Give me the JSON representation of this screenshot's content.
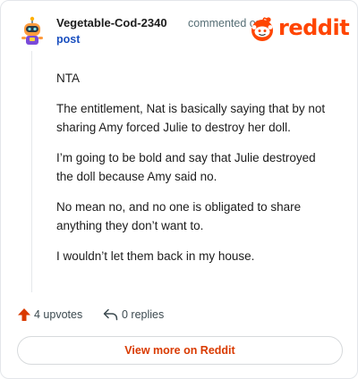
{
  "header": {
    "author": "Vegetable-Cod-2340",
    "action": "commented on",
    "target": "post",
    "brand": "reddit"
  },
  "comment": {
    "paragraphs": [
      "NTA",
      "The entitlement, Nat is basically saying that by not sharing Amy forced Julie to destroy her doll.",
      "I’m going to be bold and say that Julie destroyed the doll because Amy said no.",
      "No mean no, and no one is obligated to share anything they don’t want to.",
      "I wouldn’t let them back in my house."
    ]
  },
  "actions": {
    "upvotes": "4 upvotes",
    "replies": "0 replies"
  },
  "footer": {
    "view_more": "View more on Reddit"
  },
  "colors": {
    "brand": "#ff4500",
    "link": "#1a4fbf",
    "upvote": "#d93a00"
  }
}
